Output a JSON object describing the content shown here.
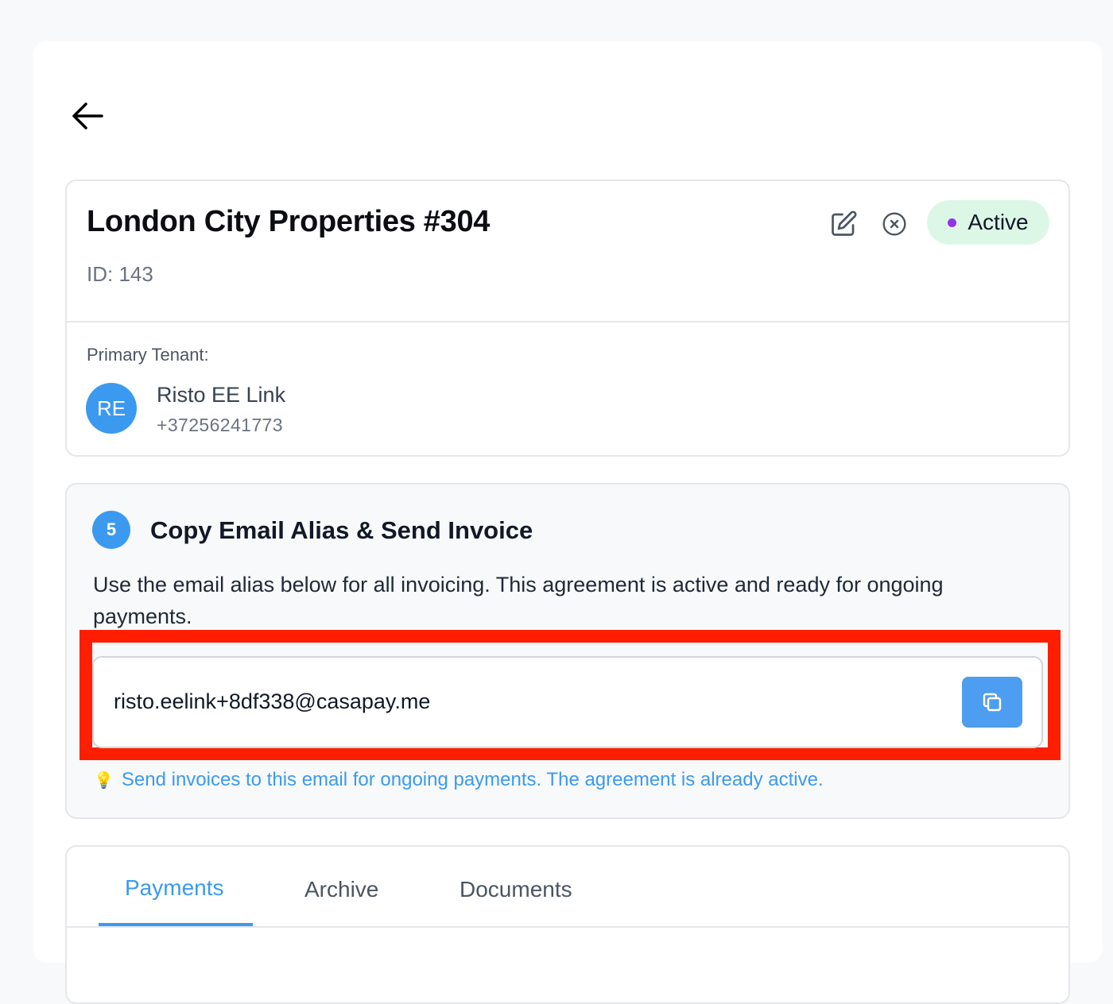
{
  "header": {
    "title": "London City Properties #304",
    "id_label": "ID: 143",
    "status": "Active",
    "status_color": "#9333ea",
    "actions": [
      "edit-icon",
      "cancel-icon"
    ]
  },
  "tenant": {
    "label": "Primary Tenant:",
    "initials": "RE",
    "name": "Risto EE Link",
    "phone": "+37256241773"
  },
  "alias_step": {
    "step_number": "5",
    "title": "Copy Email Alias & Send Invoice",
    "description": "Use the email alias below for all invoicing. This agreement is active and ready for ongoing payments.",
    "email_alias": "risto.eelink+8df338@casapay.me",
    "hint": "Send invoices to this email for ongoing payments. The agreement is already active.",
    "hint_icon": "lightbulb-icon"
  },
  "tabs": [
    {
      "label": "Payments",
      "active": true
    },
    {
      "label": "Archive",
      "active": false
    },
    {
      "label": "Documents",
      "active": false
    }
  ],
  "colors": {
    "accent": "#3b9aef",
    "active_pill_bg": "#ddf7e6",
    "highlight": "#ff1e00"
  }
}
